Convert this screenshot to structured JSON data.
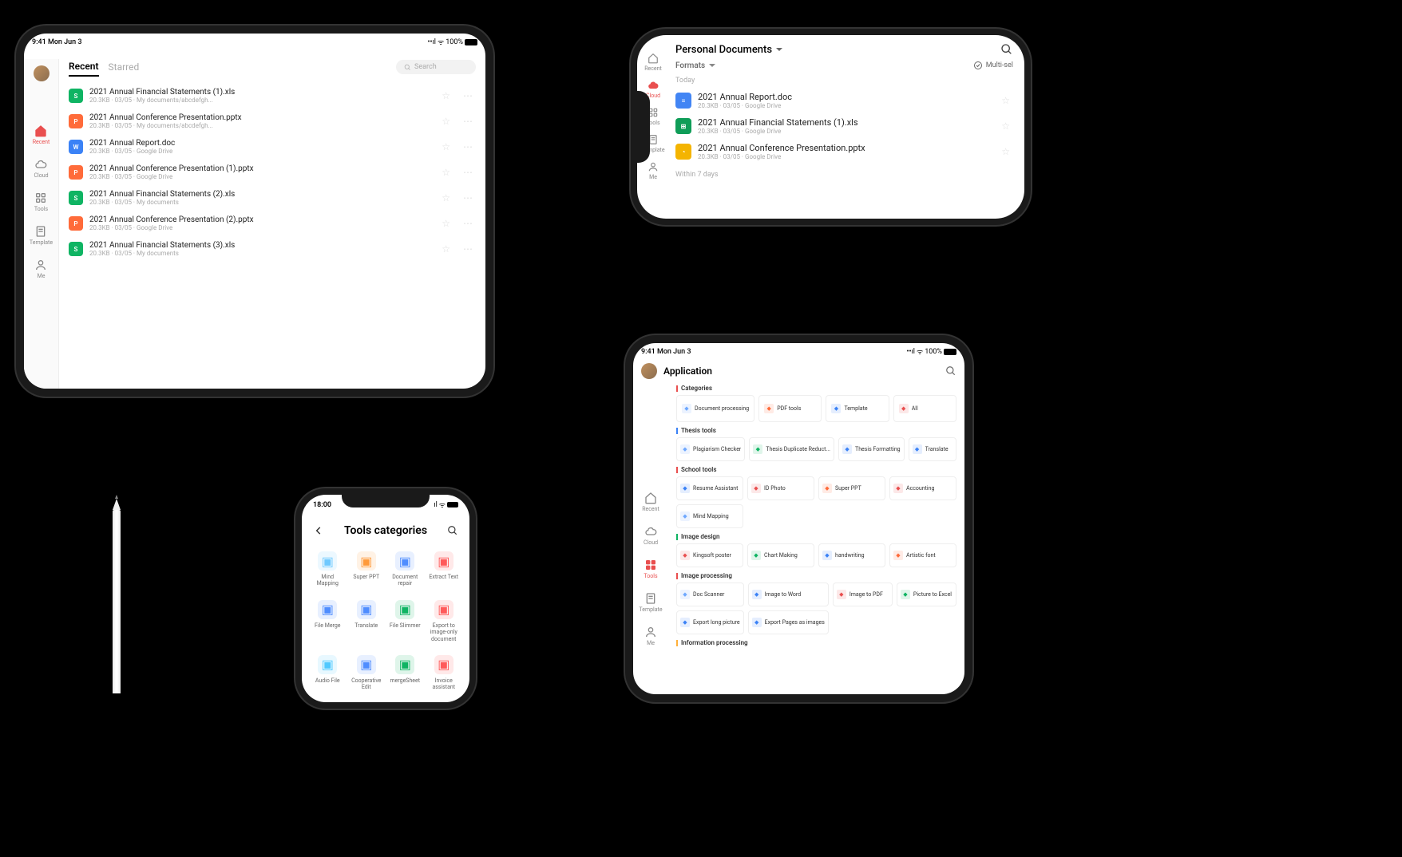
{
  "status": {
    "time_date": "9:41  Mon Jun 3",
    "battery": "100%"
  },
  "ipad1": {
    "tabs": [
      "Recent",
      "Starred"
    ],
    "search_placeholder": "Search",
    "nav": [
      {
        "k": "recent",
        "l": "Recent"
      },
      {
        "k": "cloud",
        "l": "Cloud"
      },
      {
        "k": "tools",
        "l": "Tools"
      },
      {
        "k": "template",
        "l": "Template"
      },
      {
        "k": "me",
        "l": "Me"
      }
    ],
    "files": [
      {
        "ic": "xls",
        "name": "2021 Annual Financial Statements (1).xls",
        "meta": "20.3KB · 03/05 · My documents/abcdefgh..."
      },
      {
        "ic": "ppt",
        "name": "2021 Annual Conference Presentation.pptx",
        "meta": "20.3KB · 03/05 · My documents/abcdefgh..."
      },
      {
        "ic": "doc",
        "name": "2021 Annual Report.doc",
        "meta": "20.3KB · 03/05 · Google Drive"
      },
      {
        "ic": "ppt",
        "name": "2021 Annual Conference Presentation (1).pptx",
        "meta": "20.3KB · 03/05 · Google Drive"
      },
      {
        "ic": "xls",
        "name": "2021 Annual Financial Statements (2).xls",
        "meta": "20.3KB · 03/05 · My documents"
      },
      {
        "ic": "ppt",
        "name": "2021 Annual Conference Presentation (2).pptx",
        "meta": "20.3KB · 03/05 · Google Drive"
      },
      {
        "ic": "xls",
        "name": "2021 Annual Financial Statements (3).xls",
        "meta": "20.3KB · 03/05 · My documents"
      }
    ]
  },
  "iphone1": {
    "title": "Personal Documents",
    "formats_label": "Formats",
    "multisel": "Multi-sel",
    "today": "Today",
    "within7": "Within 7 days",
    "nav": [
      {
        "k": "recent",
        "l": "Recent"
      },
      {
        "k": "cloud",
        "l": "Cloud"
      },
      {
        "k": "tools",
        "l": "Tools"
      },
      {
        "k": "template",
        "l": "Template"
      },
      {
        "k": "me",
        "l": "Me"
      }
    ],
    "files": [
      {
        "ic": "gd",
        "name": "2021 Annual Report.doc",
        "meta": "20.3KB · 03/05 · Google Drive"
      },
      {
        "ic": "gs",
        "name": "2021 Annual Financial Statements (1).xls",
        "meta": "20.3KB · 03/05 · Google Drive"
      },
      {
        "ic": "gp",
        "name": "2021 Annual Conference Presentation.pptx",
        "meta": "20.3KB · 03/05 · Google Drive"
      }
    ]
  },
  "ipad2": {
    "title": "Application",
    "nav": [
      {
        "k": "recent",
        "l": "Recent"
      },
      {
        "k": "cloud",
        "l": "Cloud"
      },
      {
        "k": "tools",
        "l": "Tools"
      },
      {
        "k": "template",
        "l": "Template"
      },
      {
        "k": "me",
        "l": "Me"
      }
    ],
    "sections": [
      {
        "title": "Categories",
        "bar": "#e94f4f",
        "items": [
          {
            "l": "Document processing",
            "c": "#6ea8ff"
          },
          {
            "l": "PDF tools",
            "c": "#ff6b3a"
          },
          {
            "l": "Template",
            "c": "#3b82f6"
          },
          {
            "l": "All",
            "c": "#e94f4f"
          }
        ],
        "cat": true
      },
      {
        "title": "Thesis tools",
        "bar": "#3b82f6",
        "items": [
          {
            "l": "Plagiarism Checker",
            "c": "#6ea8ff"
          },
          {
            "l": "Thesis Duplicate Reduct...",
            "c": "#0fb463"
          },
          {
            "l": "Thesis Formatting",
            "c": "#3b82f6"
          },
          {
            "l": "Translate",
            "c": "#3b82f6"
          }
        ]
      },
      {
        "title": "School tools",
        "bar": "#e94f4f",
        "items": [
          {
            "l": "Resume Assistant",
            "c": "#3b82f6"
          },
          {
            "l": "ID Photo",
            "c": "#e94f4f"
          },
          {
            "l": "Super PPT",
            "c": "#ff6b3a"
          },
          {
            "l": "Accounting",
            "c": "#e94f4f"
          },
          {
            "l": "Mind Mapping",
            "c": "#6ea8ff"
          }
        ]
      },
      {
        "title": "Image design",
        "bar": "#0fb463",
        "items": [
          {
            "l": "Kingsoft  poster",
            "c": "#e94f4f"
          },
          {
            "l": "Chart Making",
            "c": "#0fb463"
          },
          {
            "l": "handwriting",
            "c": "#3b82f6"
          },
          {
            "l": "Artistic font",
            "c": "#ff6b3a"
          }
        ]
      },
      {
        "title": "Image processing",
        "bar": "#e94f4f",
        "items": [
          {
            "l": "Doc Scanner",
            "c": "#6ea8ff"
          },
          {
            "l": "Image to Word",
            "c": "#3b82f6"
          },
          {
            "l": "Image to PDF",
            "c": "#e94f4f"
          },
          {
            "l": "Picture to Excel",
            "c": "#0fb463"
          },
          {
            "l": "Export long picture",
            "c": "#3b82f6"
          },
          {
            "l": "Export Pages as images",
            "c": "#3b82f6"
          }
        ]
      },
      {
        "title": "Information processing",
        "bar": "#ffb03a",
        "items": []
      }
    ]
  },
  "iphone2": {
    "time": "18:00",
    "title": "Tools categories",
    "items": [
      {
        "l": "Mind Mapping",
        "c": "#6ec9ff"
      },
      {
        "l": "Super PPT",
        "c": "#ff9a3a"
      },
      {
        "l": "Document repair",
        "c": "#4f8dff"
      },
      {
        "l": "Extract Text",
        "c": "#ff5a5a"
      },
      {
        "l": "File Merge",
        "c": "#4f8dff"
      },
      {
        "l": "Translate",
        "c": "#4f8dff"
      },
      {
        "l": "File Slimmer",
        "c": "#0fb463"
      },
      {
        "l": "Export to image-only document",
        "c": "#ff5a5a"
      },
      {
        "l": "Audio File",
        "c": "#4fc9ff"
      },
      {
        "l": "Cooperative Edit",
        "c": "#4f8dff"
      },
      {
        "l": "mergeSheet",
        "c": "#0fb463"
      },
      {
        "l": "Invoice assistant",
        "c": "#ff5a5a"
      }
    ]
  }
}
